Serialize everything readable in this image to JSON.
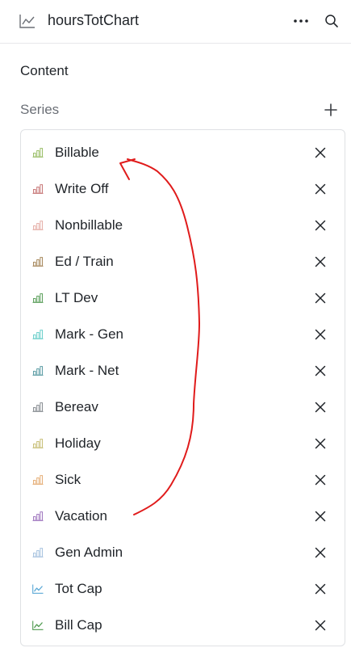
{
  "header": {
    "title": "hoursTotChart",
    "icon": "line-chart-icon",
    "more_icon": "more-horizontal-icon",
    "search_icon": "search-icon"
  },
  "content": {
    "section_title": "Content",
    "series_label": "Series",
    "add_icon": "plus-icon",
    "remove_icon": "close-icon"
  },
  "series": [
    {
      "label": "Billable",
      "icon": "bar-chart-icon",
      "color": "#9bbf6a"
    },
    {
      "label": "Write Off",
      "icon": "bar-chart-icon",
      "color": "#c97a7a"
    },
    {
      "label": "Nonbillable",
      "icon": "bar-chart-icon",
      "color": "#e6b1aa"
    },
    {
      "label": "Ed / Train",
      "icon": "bar-chart-icon",
      "color": "#a88a5f"
    },
    {
      "label": "LT Dev",
      "icon": "bar-chart-icon",
      "color": "#5fa15f"
    },
    {
      "label": "Mark - Gen",
      "icon": "bar-chart-icon",
      "color": "#6fd0cc"
    },
    {
      "label": "Mark - Net",
      "icon": "bar-chart-icon",
      "color": "#5f9ea6"
    },
    {
      "label": "Bereav",
      "icon": "bar-chart-icon",
      "color": "#8a8f94"
    },
    {
      "label": "Holiday",
      "icon": "bar-chart-icon",
      "color": "#c9c07a"
    },
    {
      "label": "Sick",
      "icon": "bar-chart-icon",
      "color": "#e6b07a"
    },
    {
      "label": "Vacation",
      "icon": "bar-chart-icon",
      "color": "#a27ac0"
    },
    {
      "label": "Gen Admin",
      "icon": "bar-chart-icon",
      "color": "#a9c4e0"
    },
    {
      "label": "Tot Cap",
      "icon": "line-chart-icon",
      "color": "#5aa8d6"
    },
    {
      "label": "Bill Cap",
      "icon": "line-chart-icon",
      "color": "#4e9a4e"
    }
  ],
  "annotation": {
    "icon": "hand-drawn-arrow-icon",
    "color": "#e01b1b"
  }
}
